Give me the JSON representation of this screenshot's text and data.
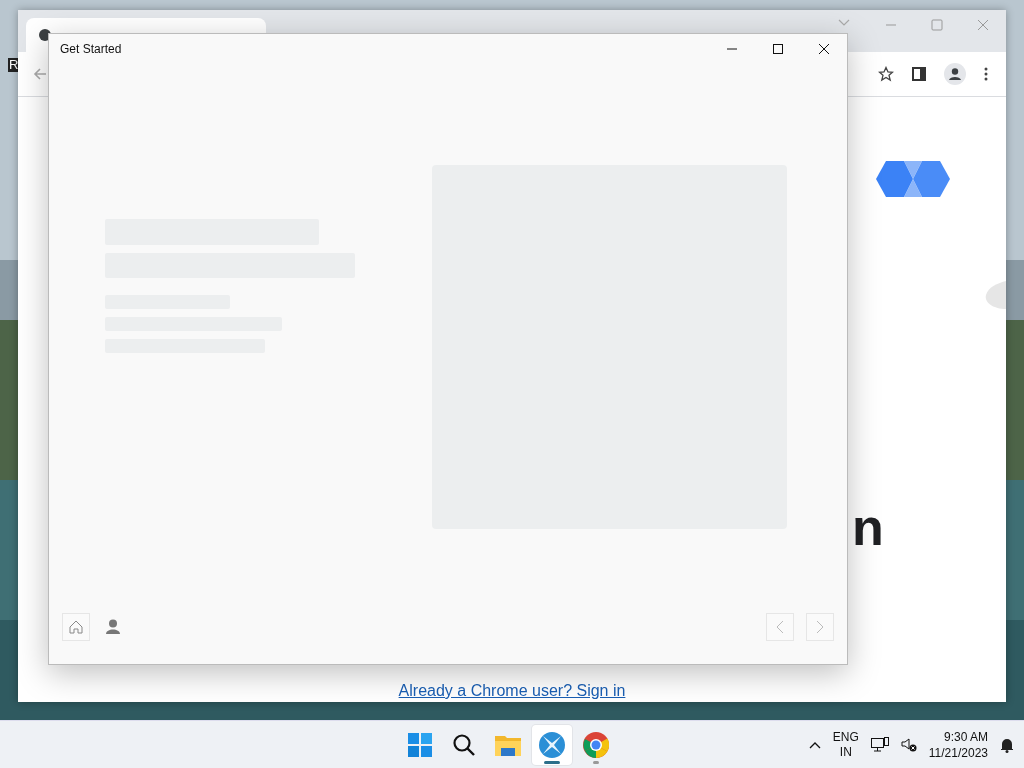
{
  "desktop": {
    "icon_label": "R"
  },
  "browser": {
    "heading_fragment": "n",
    "sign_in_link": "Already a Chrome user? Sign in"
  },
  "dialog": {
    "title": "Get Started"
  },
  "taskbar": {
    "apps": [
      {
        "kind": "start",
        "active": false,
        "running": false
      },
      {
        "kind": "search",
        "active": false,
        "running": false
      },
      {
        "kind": "files",
        "active": false,
        "running": false
      },
      {
        "kind": "app",
        "active": true,
        "running": true
      },
      {
        "kind": "chrome",
        "active": false,
        "running": true
      }
    ],
    "language": "ENG",
    "region": "IN",
    "time": "9:30 AM",
    "date": "11/21/2023"
  }
}
